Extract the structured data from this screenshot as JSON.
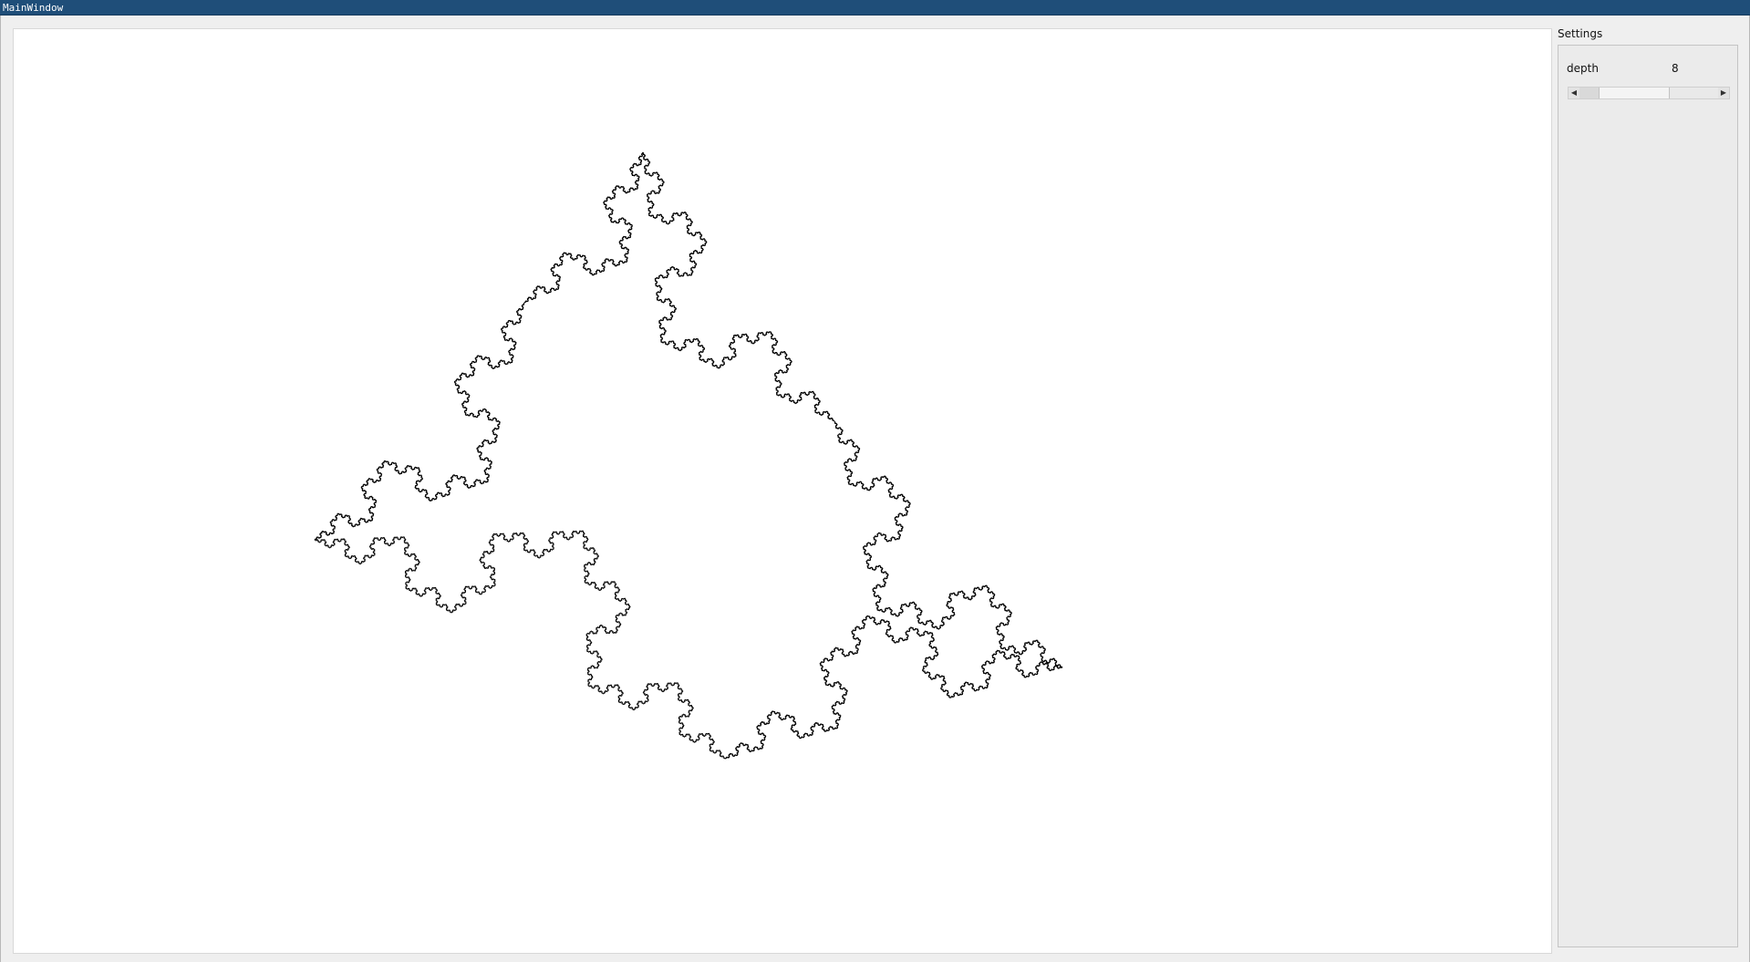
{
  "window": {
    "title": "MainWindow"
  },
  "canvas": {
    "fractal_depth": 8,
    "stroke_color": "#000000",
    "background": "#ffffff"
  },
  "settings": {
    "title": "Settings",
    "depth_label": "depth",
    "depth_value": "8",
    "depth_slider": {
      "min": 0,
      "max": 12,
      "value": 8,
      "fraction": 0.28
    }
  },
  "icons": {
    "scroll_left": "triangle-left-icon",
    "scroll_right": "triangle-right-icon"
  }
}
